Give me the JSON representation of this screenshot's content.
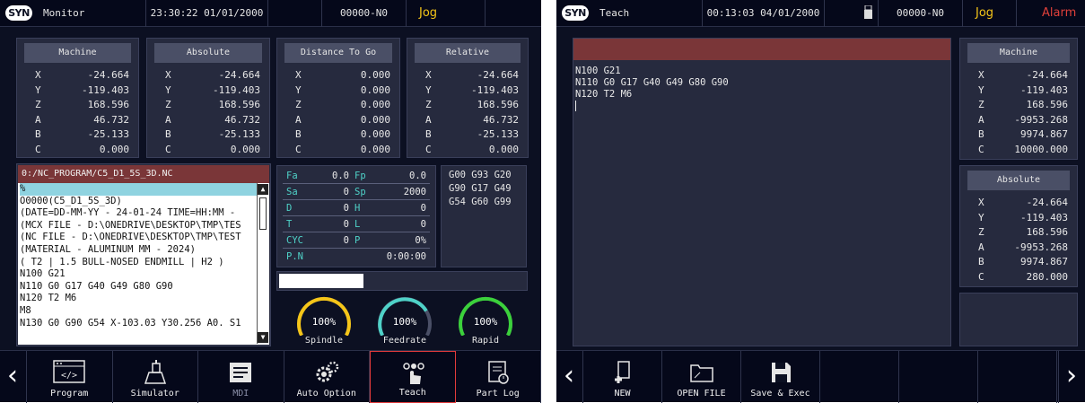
{
  "colors": {
    "accent_yellow": "#f5c518",
    "alarm_red": "#e0403a",
    "teal_label": "#4fd2c8",
    "header_red": "#7a3638"
  },
  "monitor": {
    "title": "Monitor",
    "clock": "23:30:22 01/01/2000",
    "program_id": "00000-N0",
    "mode": "Jog",
    "panels": [
      {
        "title": "Machine",
        "rows": [
          [
            "X",
            "-24.664"
          ],
          [
            "Y",
            "-119.403"
          ],
          [
            "Z",
            "168.596"
          ],
          [
            "A",
            "46.732"
          ],
          [
            "B",
            "-25.133"
          ],
          [
            "C",
            "0.000"
          ]
        ]
      },
      {
        "title": "Absolute",
        "rows": [
          [
            "X",
            "-24.664"
          ],
          [
            "Y",
            "-119.403"
          ],
          [
            "Z",
            "168.596"
          ],
          [
            "A",
            "46.732"
          ],
          [
            "B",
            "-25.133"
          ],
          [
            "C",
            "0.000"
          ]
        ]
      },
      {
        "title": "Distance To Go",
        "rows": [
          [
            "X",
            "0.000"
          ],
          [
            "Y",
            "0.000"
          ],
          [
            "Z",
            "0.000"
          ],
          [
            "A",
            "0.000"
          ],
          [
            "B",
            "0.000"
          ],
          [
            "C",
            "0.000"
          ]
        ]
      },
      {
        "title": "Relative",
        "rows": [
          [
            "X",
            "-24.664"
          ],
          [
            "Y",
            "-119.403"
          ],
          [
            "Z",
            "168.596"
          ],
          [
            "A",
            "46.732"
          ],
          [
            "B",
            "-25.133"
          ],
          [
            "C",
            "0.000"
          ]
        ]
      }
    ],
    "program_path": "0:/NC_PROGRAM/C5_D1_5S_3D.NC",
    "program_lines": [
      "%",
      "O0000(C5_D1_5S_3D)",
      "(DATE=DD-MM-YY - 24-01-24 TIME=HH:MM -",
      "(MCX FILE - D:\\ONEDRIVE\\DESKTOP\\TMP\\TES",
      "(NC FILE - D:\\ONEDRIVE\\DESKTOP\\TMP\\TEST",
      "(MATERIAL - ALUMINUM MM - 2024)",
      "( T2 | 1.5 BULL-NOSED ENDMILL | H2 )",
      "N100 G21",
      "N110 G0 G17 G40 G49 G80 G90",
      "N120 T2 M6",
      "M8",
      "N130 G0 G90 G54 X-103.03 Y30.256 A0. S1"
    ],
    "feed": [
      [
        "Fa",
        "0.0",
        "Fp",
        "0.0"
      ],
      [
        "Sa",
        "0",
        "Sp",
        "2000"
      ],
      [
        "D",
        "0",
        "H",
        "0"
      ],
      [
        "T",
        "0",
        "L",
        "0"
      ],
      [
        "CYC",
        "0",
        "P",
        "0%"
      ],
      [
        "P.N",
        "0:00:00",
        "",
        ""
      ]
    ],
    "gcodes": [
      "G00 G93 G20",
      "G90 G17 G49",
      "G54 G60 G99"
    ],
    "progress": 0.34,
    "gauges": [
      {
        "value": "100%",
        "label": "Spindle",
        "color": "#f5c518",
        "fill": 1.0
      },
      {
        "value": "100%",
        "label": "Feedrate",
        "color": "#4fd2c8",
        "fill": 0.75
      },
      {
        "value": "100%",
        "label": "Rapid",
        "color": "#3bd13b",
        "fill": 1.0
      }
    ],
    "buttons": [
      {
        "label": "Program",
        "icon": "code-icon"
      },
      {
        "label": "Simulator",
        "icon": "simulator-icon"
      },
      {
        "label": "MDI",
        "icon": "mdi-icon"
      },
      {
        "label": "Auto Option",
        "icon": "gears-icon"
      },
      {
        "label": "Teach",
        "icon": "teach-hand-icon"
      },
      {
        "label": "Part Log",
        "icon": "log-icon"
      }
    ]
  },
  "teach": {
    "title": "Teach",
    "clock": "00:13:03 04/01/2000",
    "program_id": "00000-N0",
    "mode": "Jog",
    "alarm": "Alarm",
    "editor_lines": [
      "N100 G21",
      "N110 G0 G17 G40 G49 G80 G90",
      "N120 T2 M6"
    ],
    "panels": [
      {
        "title": "Machine",
        "rows": [
          [
            "X",
            "-24.664"
          ],
          [
            "Y",
            "-119.403"
          ],
          [
            "Z",
            "168.596"
          ],
          [
            "A",
            "-9953.268"
          ],
          [
            "B",
            "9974.867"
          ],
          [
            "C",
            "10000.000"
          ]
        ]
      },
      {
        "title": "Absolute",
        "rows": [
          [
            "X",
            "-24.664"
          ],
          [
            "Y",
            "-119.403"
          ],
          [
            "Z",
            "168.596"
          ],
          [
            "A",
            "-9953.268"
          ],
          [
            "B",
            "9974.867"
          ],
          [
            "C",
            "280.000"
          ]
        ]
      }
    ],
    "buttons": [
      {
        "label": "NEW",
        "icon": "new-file-icon"
      },
      {
        "label": "OPEN FILE",
        "icon": "folder-icon"
      },
      {
        "label": "Save & Exec",
        "icon": "save-icon"
      }
    ]
  }
}
